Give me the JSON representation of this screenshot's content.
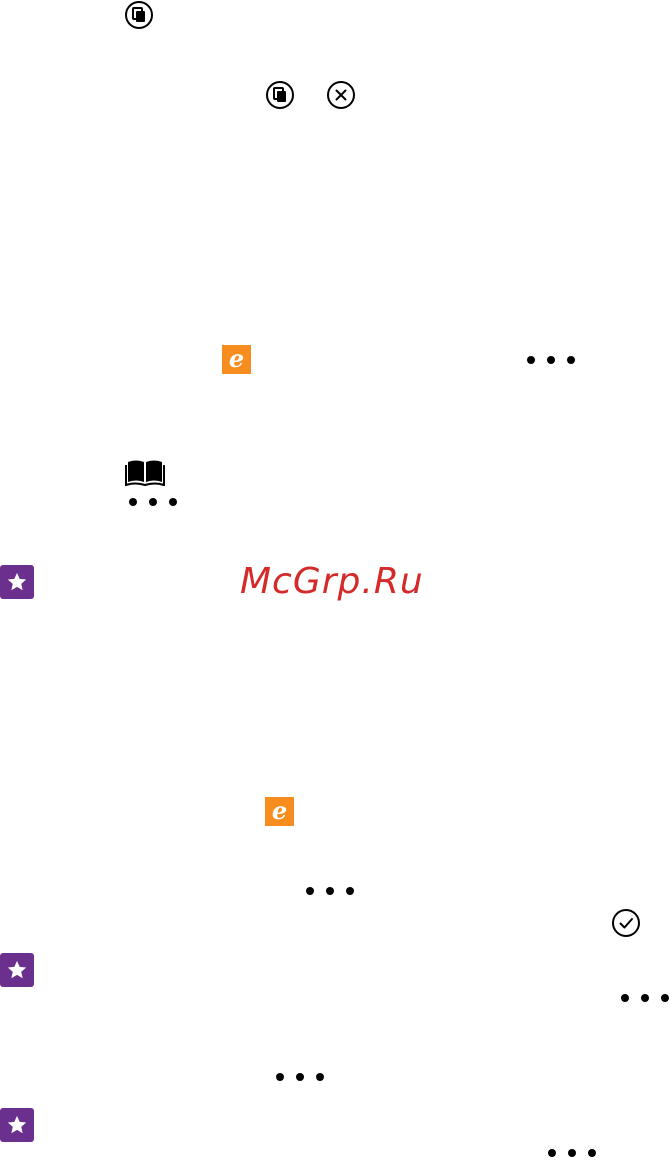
{
  "colors": {
    "ie_tile": "#f78d1e",
    "star_tile": "#6b2f8e",
    "watermark": "#d42a2a",
    "icon": "#000000"
  },
  "watermark": {
    "text": "McGrp.Ru"
  },
  "icons": [
    "switch-windows-icon",
    "close-icon",
    "internet-explorer-icon",
    "more-icon",
    "reading-view-icon",
    "tip-star-icon",
    "checkmark-icon"
  ],
  "ie_tile": {
    "glyph": "e"
  }
}
